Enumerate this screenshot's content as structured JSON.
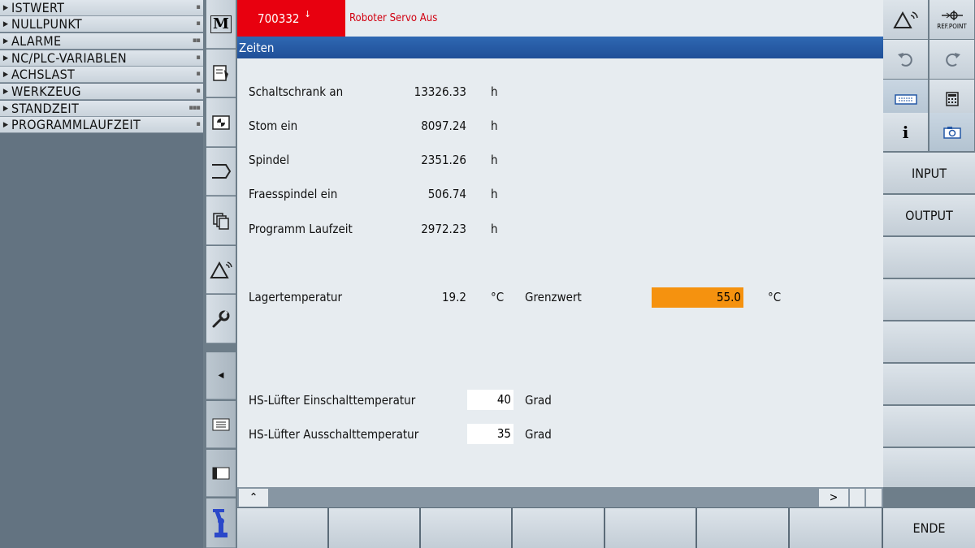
{
  "left_menu": [
    {
      "label": "ISTWERT",
      "marker": "▪"
    },
    {
      "label": "NULLPUNKT",
      "marker": "▪"
    },
    {
      "label": "ALARME",
      "marker": "▪▪"
    },
    {
      "label": "NC/PLC-VARIABLEN",
      "marker": "▪"
    },
    {
      "label": "ACHSLAST",
      "marker": "▪"
    },
    {
      "label": "WERKZEUG",
      "marker": "▪"
    },
    {
      "label": "STANDZEIT",
      "marker": "▪▪▪"
    },
    {
      "label": "PROGRAMMLAUFZEIT",
      "marker": "▪"
    }
  ],
  "header": {
    "alarm_number": "700332",
    "alarm_arrow": "↓",
    "alarm_text": "Roboter Servo Aus"
  },
  "title": "Zeiten",
  "times": [
    {
      "label": "Schaltschrank an",
      "value": "13326.33",
      "unit": "h"
    },
    {
      "label": "Stom ein",
      "value": "8097.24",
      "unit": "h"
    },
    {
      "label": "Spindel",
      "value": "2351.26",
      "unit": "h"
    },
    {
      "label": "Fraesspindel ein",
      "value": "506.74",
      "unit": "h"
    },
    {
      "label": "Programm Laufzeit",
      "value": "2972.23",
      "unit": "h"
    }
  ],
  "bearing": {
    "label": "Lagertemperatur",
    "value": "19.2",
    "unit": "°C",
    "limit_label": "Grenzwert",
    "limit_value": "55.0",
    "limit_unit": "°C"
  },
  "fan": [
    {
      "label": "HS-Lüfter Einschalttemperatur",
      "value": "40",
      "unit": "Grad"
    },
    {
      "label": "HS-Lüfter Ausschalttemperatur",
      "value": "35",
      "unit": "Grad"
    }
  ],
  "scroll": {
    "up": "⌃",
    "right": ">"
  },
  "right_softkeys": {
    "refpoint": "REF.POINT",
    "input": "INPUT",
    "output": "OUTPUT",
    "info": "i",
    "ende": "ENDE"
  },
  "vbar_icons": [
    "machine-icon",
    "program-icon",
    "offset-icon",
    "program-manager-icon",
    "copy-icon",
    "diagnostics-icon",
    "setup-icon"
  ],
  "colors": {
    "alarm": "#e8000f",
    "title": "#2458a6",
    "limit": "#f5920f"
  }
}
